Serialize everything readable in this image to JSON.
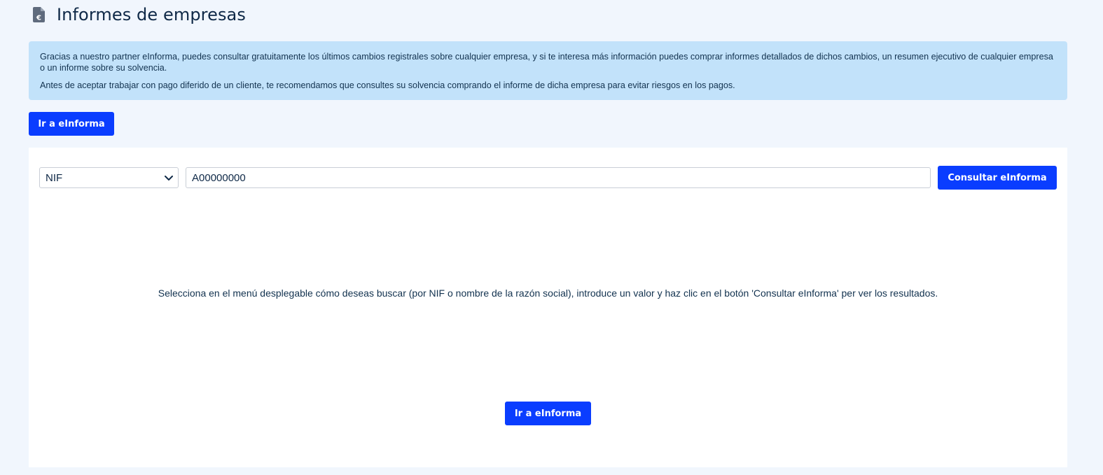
{
  "header": {
    "title": "Informes de empresas",
    "icon": "euro-document-icon"
  },
  "info": {
    "paragraph1": "Gracias a nuestro partner eInforma, puedes consultar gratuitamente los últimos cambios registrales sobre cualquier empresa, y si te interesa más información puedes comprar informes detallados de dichos cambios, un resumen ejecutivo de cualquier empresa o un informe sobre su solvencia.",
    "paragraph2": "Antes de aceptar trabajar con pago diferido de un cliente, te recomendamos que consultes su solvencia comprando el informe de dicha empresa para evitar riesgos en los pagos."
  },
  "actions": {
    "go_einforma_label": "Ir a eInforma"
  },
  "search": {
    "type_selected": "NIF",
    "value": "A00000000",
    "consult_label": "Consultar eInforma"
  },
  "results": {
    "empty_message": "Selecciona en el menú desplegable cómo deseas buscar (por NIF o nombre de la razón social), introduce un valor y haz clic en el botón 'Consultar eInforma' per ver los resultados.",
    "go_einforma_label": "Ir a eInforma"
  },
  "colors": {
    "primary": "#0a3dff",
    "info_bg": "#c2e2fa",
    "page_bg": "#f1f6fd",
    "text": "#0f2947"
  }
}
